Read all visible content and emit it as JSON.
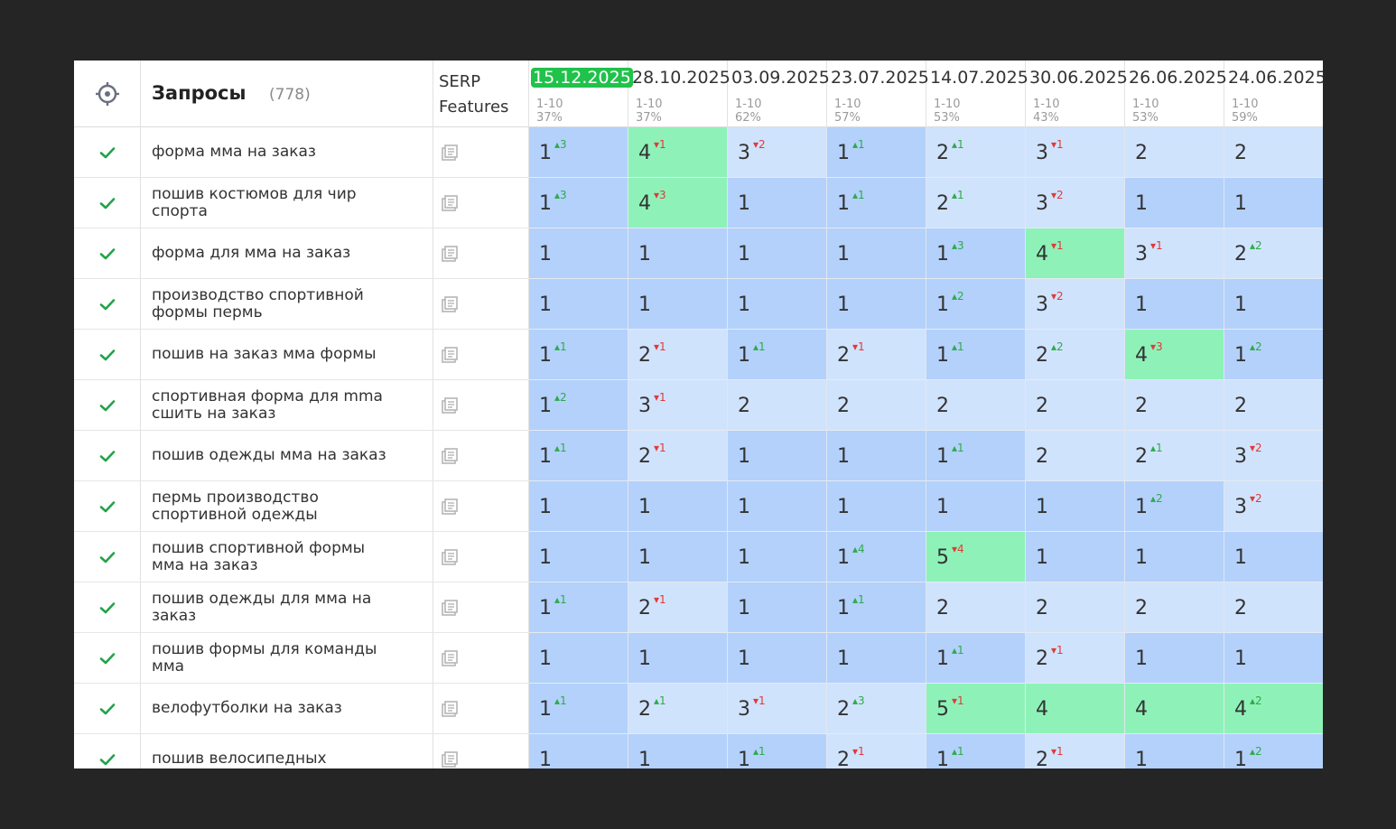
{
  "header": {
    "title": "Запросы",
    "count": "(778)",
    "serp_label_1": "SERP",
    "serp_label_2": "Features"
  },
  "colors": {
    "background": "#252525",
    "highlight_date": "#20c24a",
    "pos_1": "#b3d1fb",
    "pos_2_3": "#d0e3fd",
    "pos_4_5": "#8ef2b8",
    "delta_up": "#2eaa4a",
    "delta_down": "#e03a3a",
    "check": "#23a34a"
  },
  "icons": {
    "target": "crosshair-target-icon",
    "check": "check-icon",
    "serp": "serp-features-icon"
  },
  "dates": [
    {
      "date": "15.12.2025",
      "range": "1-10",
      "pct": "37%",
      "highlight": true
    },
    {
      "date": "28.10.2025",
      "range": "1-10",
      "pct": "37%"
    },
    {
      "date": "03.09.2025",
      "range": "1-10",
      "pct": "62%"
    },
    {
      "date": "23.07.2025",
      "range": "1-10",
      "pct": "57%"
    },
    {
      "date": "14.07.2025",
      "range": "1-10",
      "pct": "53%"
    },
    {
      "date": "30.06.2025",
      "range": "1-10",
      "pct": "43%"
    },
    {
      "date": "26.06.2025",
      "range": "1-10",
      "pct": "53%"
    },
    {
      "date": "24.06.2025",
      "range": "1-10",
      "pct": "59%"
    }
  ],
  "rows": [
    {
      "query": "форма мма на заказ",
      "cells": [
        {
          "v": "1",
          "d": "3",
          "dir": "up"
        },
        {
          "v": "4",
          "d": "1",
          "dir": "down"
        },
        {
          "v": "3",
          "d": "2",
          "dir": "down"
        },
        {
          "v": "1",
          "d": "1",
          "dir": "up"
        },
        {
          "v": "2",
          "d": "1",
          "dir": "up"
        },
        {
          "v": "3",
          "d": "1",
          "dir": "down"
        },
        {
          "v": "2"
        },
        {
          "v": "2"
        }
      ]
    },
    {
      "query": "пошив костюмов для чир спорта",
      "cells": [
        {
          "v": "1",
          "d": "3",
          "dir": "up"
        },
        {
          "v": "4",
          "d": "3",
          "dir": "down"
        },
        {
          "v": "1"
        },
        {
          "v": "1",
          "d": "1",
          "dir": "up"
        },
        {
          "v": "2",
          "d": "1",
          "dir": "up"
        },
        {
          "v": "3",
          "d": "2",
          "dir": "down"
        },
        {
          "v": "1"
        },
        {
          "v": "1"
        }
      ]
    },
    {
      "query": "форма для мма на заказ",
      "cells": [
        {
          "v": "1"
        },
        {
          "v": "1"
        },
        {
          "v": "1"
        },
        {
          "v": "1"
        },
        {
          "v": "1",
          "d": "3",
          "dir": "up"
        },
        {
          "v": "4",
          "d": "1",
          "dir": "down"
        },
        {
          "v": "3",
          "d": "1",
          "dir": "down"
        },
        {
          "v": "2",
          "d": "2",
          "dir": "up"
        }
      ]
    },
    {
      "query": "производство спортивной формы пермь",
      "cells": [
        {
          "v": "1"
        },
        {
          "v": "1"
        },
        {
          "v": "1"
        },
        {
          "v": "1"
        },
        {
          "v": "1",
          "d": "2",
          "dir": "up"
        },
        {
          "v": "3",
          "d": "2",
          "dir": "down"
        },
        {
          "v": "1"
        },
        {
          "v": "1"
        }
      ]
    },
    {
      "query": "пошив на заказ мма формы",
      "cells": [
        {
          "v": "1",
          "d": "1",
          "dir": "up"
        },
        {
          "v": "2",
          "d": "1",
          "dir": "down"
        },
        {
          "v": "1",
          "d": "1",
          "dir": "up"
        },
        {
          "v": "2",
          "d": "1",
          "dir": "down"
        },
        {
          "v": "1",
          "d": "1",
          "dir": "up"
        },
        {
          "v": "2",
          "d": "2",
          "dir": "up"
        },
        {
          "v": "4",
          "d": "3",
          "dir": "down"
        },
        {
          "v": "1",
          "d": "2",
          "dir": "up"
        }
      ]
    },
    {
      "query": "спортивная форма для mma сшить на заказ",
      "cells": [
        {
          "v": "1",
          "d": "2",
          "dir": "up"
        },
        {
          "v": "3",
          "d": "1",
          "dir": "down"
        },
        {
          "v": "2"
        },
        {
          "v": "2"
        },
        {
          "v": "2"
        },
        {
          "v": "2"
        },
        {
          "v": "2"
        },
        {
          "v": "2"
        }
      ]
    },
    {
      "query": "пошив одежды мма на заказ",
      "cells": [
        {
          "v": "1",
          "d": "1",
          "dir": "up"
        },
        {
          "v": "2",
          "d": "1",
          "dir": "down"
        },
        {
          "v": "1"
        },
        {
          "v": "1"
        },
        {
          "v": "1",
          "d": "1",
          "dir": "up"
        },
        {
          "v": "2"
        },
        {
          "v": "2",
          "d": "1",
          "dir": "up"
        },
        {
          "v": "3",
          "d": "2",
          "dir": "down"
        }
      ]
    },
    {
      "query": "пермь производство спортивной одежды",
      "cells": [
        {
          "v": "1"
        },
        {
          "v": "1"
        },
        {
          "v": "1"
        },
        {
          "v": "1"
        },
        {
          "v": "1"
        },
        {
          "v": "1"
        },
        {
          "v": "1",
          "d": "2",
          "dir": "up"
        },
        {
          "v": "3",
          "d": "2",
          "dir": "down"
        }
      ]
    },
    {
      "query": "пошив спортивной формы мма на заказ",
      "cells": [
        {
          "v": "1"
        },
        {
          "v": "1"
        },
        {
          "v": "1"
        },
        {
          "v": "1",
          "d": "4",
          "dir": "up"
        },
        {
          "v": "5",
          "d": "4",
          "dir": "down"
        },
        {
          "v": "1"
        },
        {
          "v": "1"
        },
        {
          "v": "1"
        }
      ]
    },
    {
      "query": "пошив одежды для мма на заказ",
      "cells": [
        {
          "v": "1",
          "d": "1",
          "dir": "up"
        },
        {
          "v": "2",
          "d": "1",
          "dir": "down"
        },
        {
          "v": "1"
        },
        {
          "v": "1",
          "d": "1",
          "dir": "up"
        },
        {
          "v": "2"
        },
        {
          "v": "2"
        },
        {
          "v": "2"
        },
        {
          "v": "2"
        }
      ]
    },
    {
      "query": "пошив формы для команды мма",
      "cells": [
        {
          "v": "1"
        },
        {
          "v": "1"
        },
        {
          "v": "1"
        },
        {
          "v": "1"
        },
        {
          "v": "1",
          "d": "1",
          "dir": "up"
        },
        {
          "v": "2",
          "d": "1",
          "dir": "down"
        },
        {
          "v": "1"
        },
        {
          "v": "1"
        }
      ]
    },
    {
      "query": "велофутболки на заказ",
      "cells": [
        {
          "v": "1",
          "d": "1",
          "dir": "up"
        },
        {
          "v": "2",
          "d": "1",
          "dir": "up"
        },
        {
          "v": "3",
          "d": "1",
          "dir": "down"
        },
        {
          "v": "2",
          "d": "3",
          "dir": "up"
        },
        {
          "v": "5",
          "d": "1",
          "dir": "down"
        },
        {
          "v": "4"
        },
        {
          "v": "4"
        },
        {
          "v": "4",
          "d": "2",
          "dir": "up"
        }
      ]
    },
    {
      "query": "пошив велосипедных",
      "cells": [
        {
          "v": "1"
        },
        {
          "v": "1"
        },
        {
          "v": "1",
          "d": "1",
          "dir": "up"
        },
        {
          "v": "2",
          "d": "1",
          "dir": "down"
        },
        {
          "v": "1",
          "d": "1",
          "dir": "up"
        },
        {
          "v": "2",
          "d": "1",
          "dir": "down"
        },
        {
          "v": "1"
        },
        {
          "v": "1",
          "d": "2",
          "dir": "up"
        }
      ]
    }
  ]
}
